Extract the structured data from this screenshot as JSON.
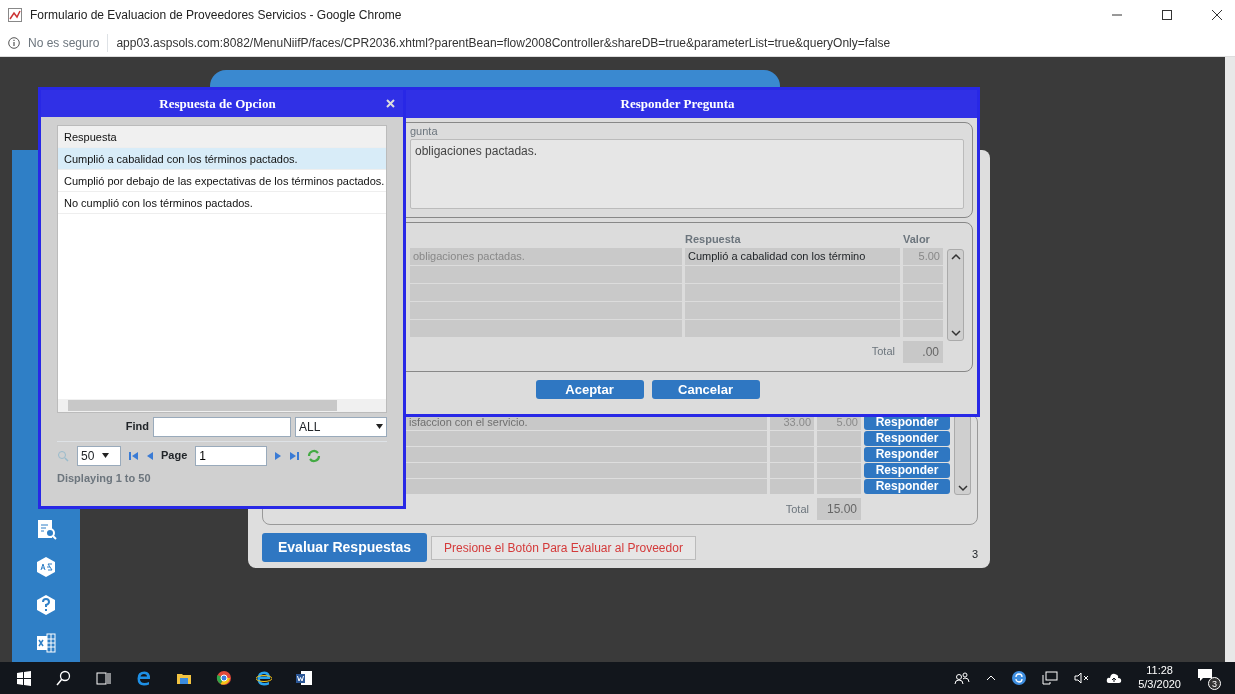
{
  "browser": {
    "title": "Formulario de Evaluacion de Proveedores Servicios - Google Chrome",
    "security": "No es seguro",
    "url": "app03.aspsols.com:8082/MenuNiifP/faces/CPR2036.xhtml?parentBean=flow2008Controller&shareDB=true&parameterList=true&queryOnly=false"
  },
  "background_form": {
    "rows": [
      {
        "text": "isfaccion con el servicio.",
        "column_2": "33.00",
        "column_3": "5.00",
        "button": "Responder"
      },
      {
        "button": "Responder"
      },
      {
        "button": "Responder"
      },
      {
        "button": "Responder"
      },
      {
        "button": "Responder"
      }
    ],
    "total_label": "Total",
    "total": "15.00",
    "evaluate_button": "Evaluar Respuestas",
    "message": "Presione el Botón Para Evaluar al Proveedor",
    "page_number": "3"
  },
  "question_dialog": {
    "title": "Responder Pregunta",
    "question_label": "gunta",
    "question_text": "obligaciones pactadas.",
    "columns": [
      "Respuesta",
      "Valor"
    ],
    "rows": [
      {
        "question": "obligaciones pactadas.",
        "answer": "Cumplió a cabalidad con los término",
        "value": "5.00"
      }
    ],
    "total_label": "Total",
    "total": ".00",
    "buttons": [
      "Aceptar",
      "Cancelar"
    ]
  },
  "options_dialog": {
    "title": "Respuesta de Opcion",
    "column": "Respuesta",
    "rows": [
      {
        "text": "Cumplió a cabalidad con los términos pactados.",
        "selected": true
      },
      {
        "text": "Cumplió por debajo de las expectativas de los términos pactados.",
        "selected": false
      },
      {
        "text": "No cumplió con los términos pactados.",
        "selected": false
      }
    ],
    "find_label": "Find",
    "filter": "ALL",
    "page_size": "50",
    "page_label": "Page",
    "page": "1",
    "status": "Displaying 1 to 50"
  },
  "taskbar": {
    "time": "11:28",
    "date": "5/3/2020",
    "notifications": "3"
  }
}
